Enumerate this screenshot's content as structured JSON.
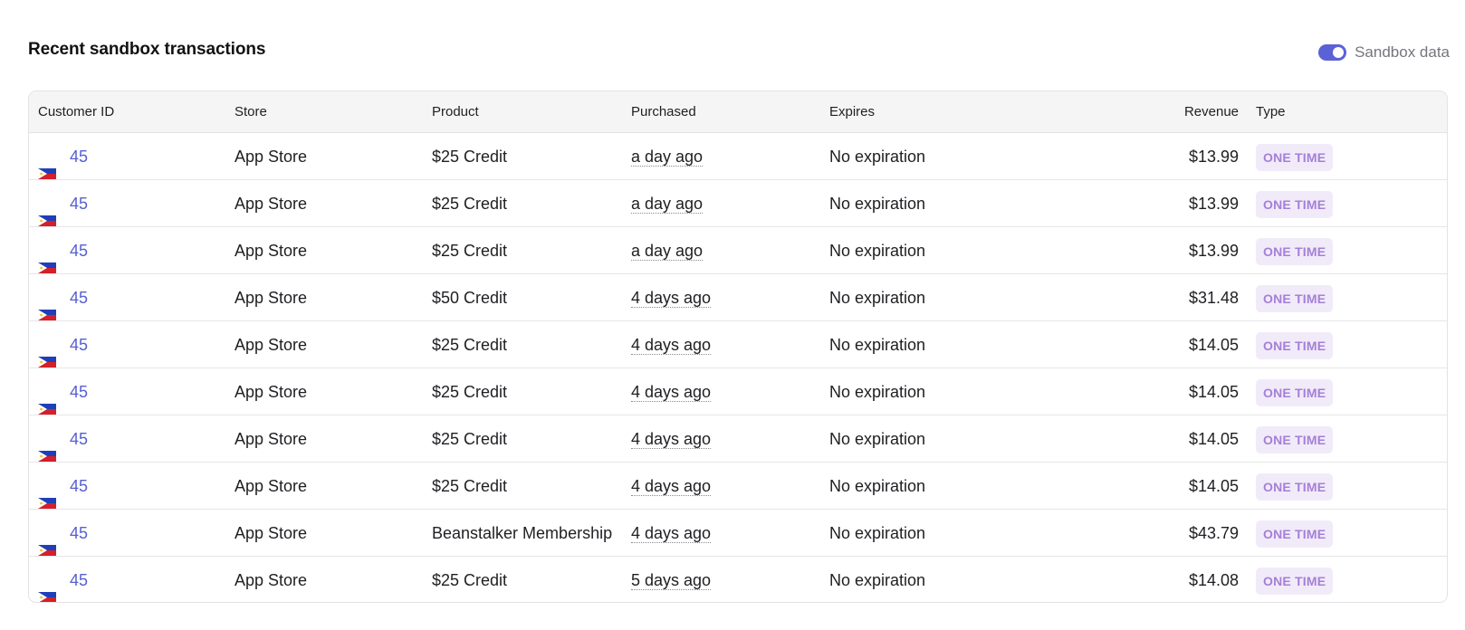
{
  "section": {
    "title": "Recent sandbox transactions",
    "toggle_label": "Sandbox data",
    "toggle_on": true
  },
  "colors": {
    "accent": "#5b62d6",
    "link": "#5660d1",
    "badge_bg": "#f1ebf9",
    "badge_text": "#a57fd8"
  },
  "table": {
    "columns": {
      "customer_id": "Customer ID",
      "store": "Store",
      "product": "Product",
      "purchased": "Purchased",
      "expires": "Expires",
      "revenue": "Revenue",
      "type": "Type"
    },
    "rows": [
      {
        "flag": "philippines-flag-icon",
        "customer_id": "45",
        "store": "App Store",
        "product": "$25 Credit",
        "purchased": "a day ago",
        "expires": "No expiration",
        "revenue": "$13.99",
        "type": "ONE TIME"
      },
      {
        "flag": "philippines-flag-icon",
        "customer_id": "45",
        "store": "App Store",
        "product": "$25 Credit",
        "purchased": "a day ago",
        "expires": "No expiration",
        "revenue": "$13.99",
        "type": "ONE TIME"
      },
      {
        "flag": "philippines-flag-icon",
        "customer_id": "45",
        "store": "App Store",
        "product": "$25 Credit",
        "purchased": "a day ago",
        "expires": "No expiration",
        "revenue": "$13.99",
        "type": "ONE TIME"
      },
      {
        "flag": "philippines-flag-icon",
        "customer_id": "45",
        "store": "App Store",
        "product": "$50 Credit",
        "purchased": "4 days ago",
        "expires": "No expiration",
        "revenue": "$31.48",
        "type": "ONE TIME"
      },
      {
        "flag": "philippines-flag-icon",
        "customer_id": "45",
        "store": "App Store",
        "product": "$25 Credit",
        "purchased": "4 days ago",
        "expires": "No expiration",
        "revenue": "$14.05",
        "type": "ONE TIME"
      },
      {
        "flag": "philippines-flag-icon",
        "customer_id": "45",
        "store": "App Store",
        "product": "$25 Credit",
        "purchased": "4 days ago",
        "expires": "No expiration",
        "revenue": "$14.05",
        "type": "ONE TIME"
      },
      {
        "flag": "philippines-flag-icon",
        "customer_id": "45",
        "store": "App Store",
        "product": "$25 Credit",
        "purchased": "4 days ago",
        "expires": "No expiration",
        "revenue": "$14.05",
        "type": "ONE TIME"
      },
      {
        "flag": "philippines-flag-icon",
        "customer_id": "45",
        "store": "App Store",
        "product": "$25 Credit",
        "purchased": "4 days ago",
        "expires": "No expiration",
        "revenue": "$14.05",
        "type": "ONE TIME"
      },
      {
        "flag": "philippines-flag-icon",
        "customer_id": "45",
        "store": "App Store",
        "product": "Beanstalker Membership",
        "purchased": "4 days ago",
        "expires": "No expiration",
        "revenue": "$43.79",
        "type": "ONE TIME"
      },
      {
        "flag": "philippines-flag-icon",
        "customer_id": "45",
        "store": "App Store",
        "product": "$25 Credit",
        "purchased": "5 days ago",
        "expires": "No expiration",
        "revenue": "$14.08",
        "type": "ONE TIME"
      }
    ]
  }
}
